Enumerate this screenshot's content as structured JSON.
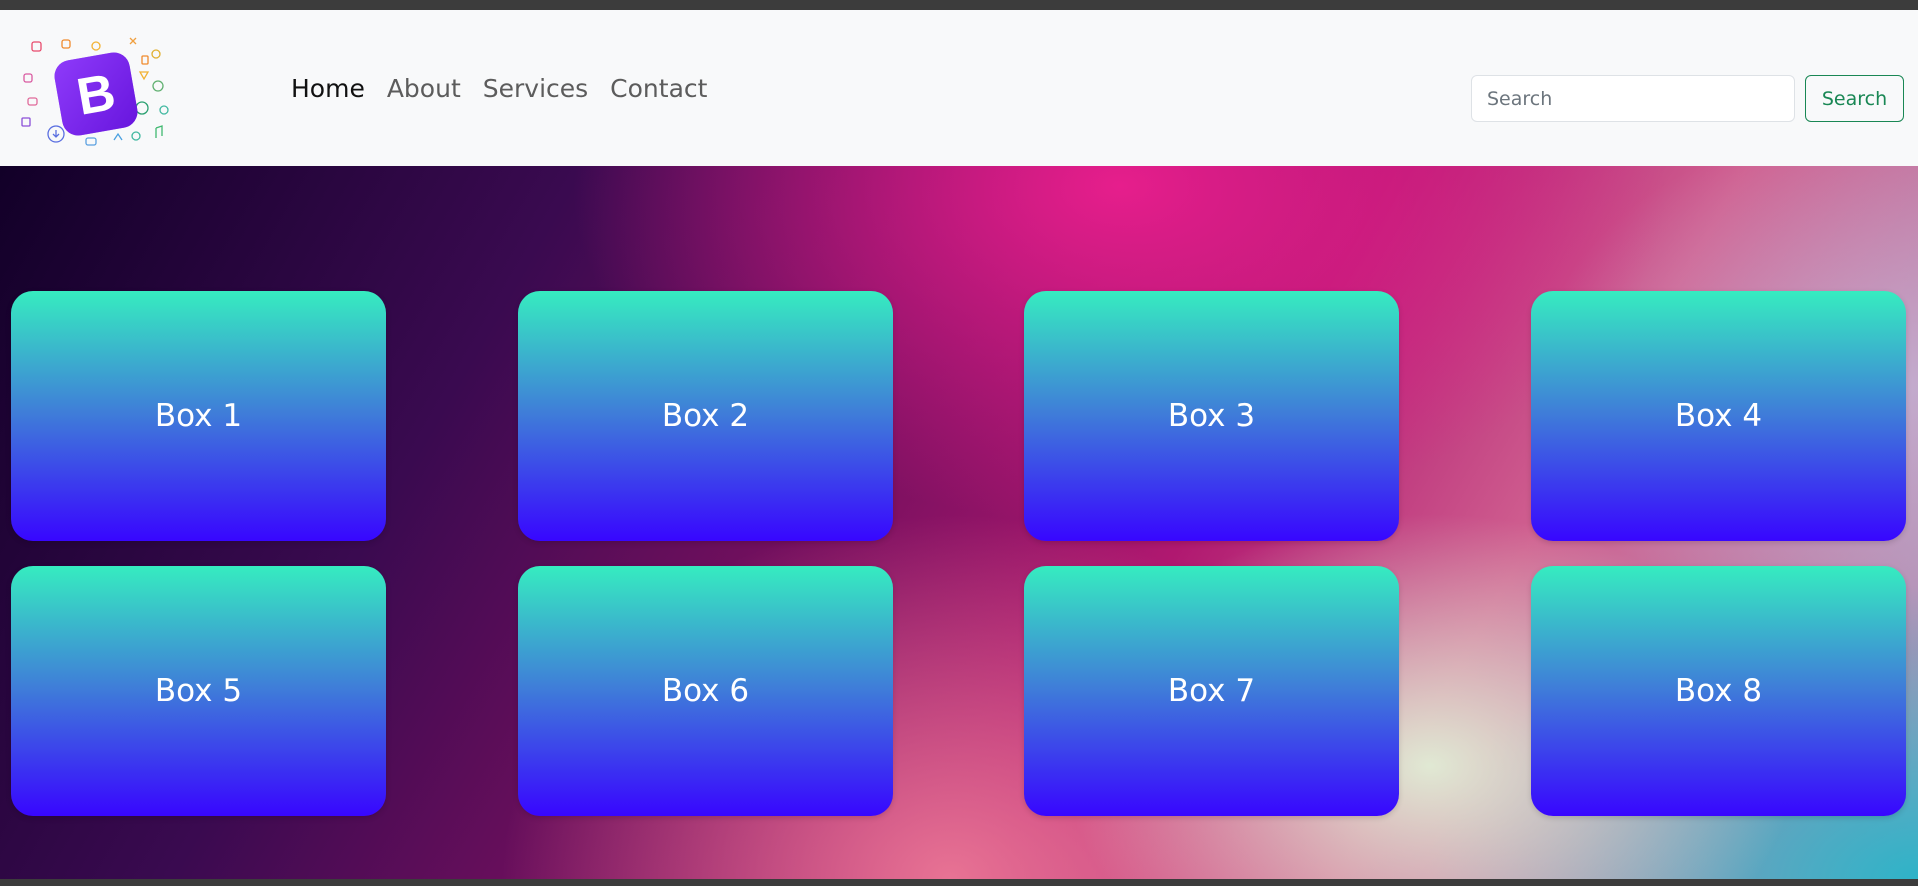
{
  "navbar": {
    "brand_logo": "bootstrap-logo",
    "links": [
      "Home",
      "About",
      "Services",
      "Contact"
    ],
    "active_link": "Home",
    "search": {
      "placeholder": "Search",
      "button_label": "Search"
    }
  },
  "boxes": [
    "Box 1",
    "Box 2",
    "Box 3",
    "Box 4",
    "Box 5",
    "Box 6",
    "Box 7",
    "Box 8"
  ],
  "colors": {
    "navbar_bg": "#f8f9fa",
    "search_button": "#198754",
    "box_gradient_top": "#36ecc0",
    "box_gradient_bottom": "#3806ff",
    "logo_purple": "#7b1ff2"
  }
}
